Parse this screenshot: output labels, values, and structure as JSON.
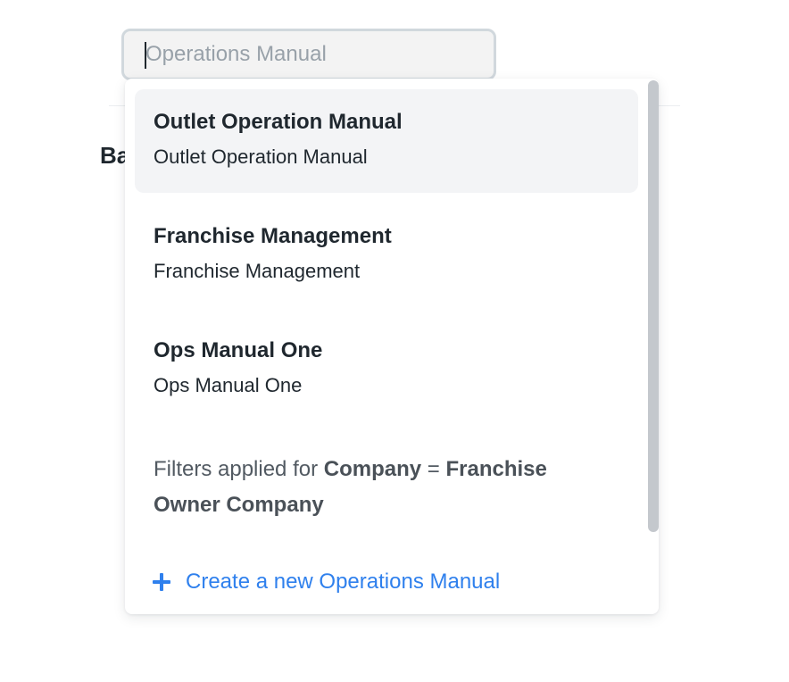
{
  "background": {
    "partial_text": "Ba"
  },
  "search": {
    "value": "",
    "placeholder": "Operations Manual"
  },
  "dropdown": {
    "options": [
      {
        "title": "Outlet Operation Manual",
        "subtitle": "Outlet Operation Manual",
        "active": true
      },
      {
        "title": "Franchise Management",
        "subtitle": "Franchise Management",
        "active": false
      },
      {
        "title": "Ops Manual One",
        "subtitle": "Ops Manual One",
        "active": false
      }
    ],
    "filters": {
      "prefix": "Filters applied for",
      "field": "Company",
      "operator": "=",
      "value": "Franchise Owner Company"
    },
    "create_label": "Create a new Operations Manual",
    "create_icon": "plus-icon"
  },
  "colors": {
    "accent": "#2f80ed",
    "active_bg": "#f3f4f6",
    "input_bg": "#f3f3f3",
    "input_border": "#d1d8dd",
    "scrollbar": "#c4c8cd"
  }
}
